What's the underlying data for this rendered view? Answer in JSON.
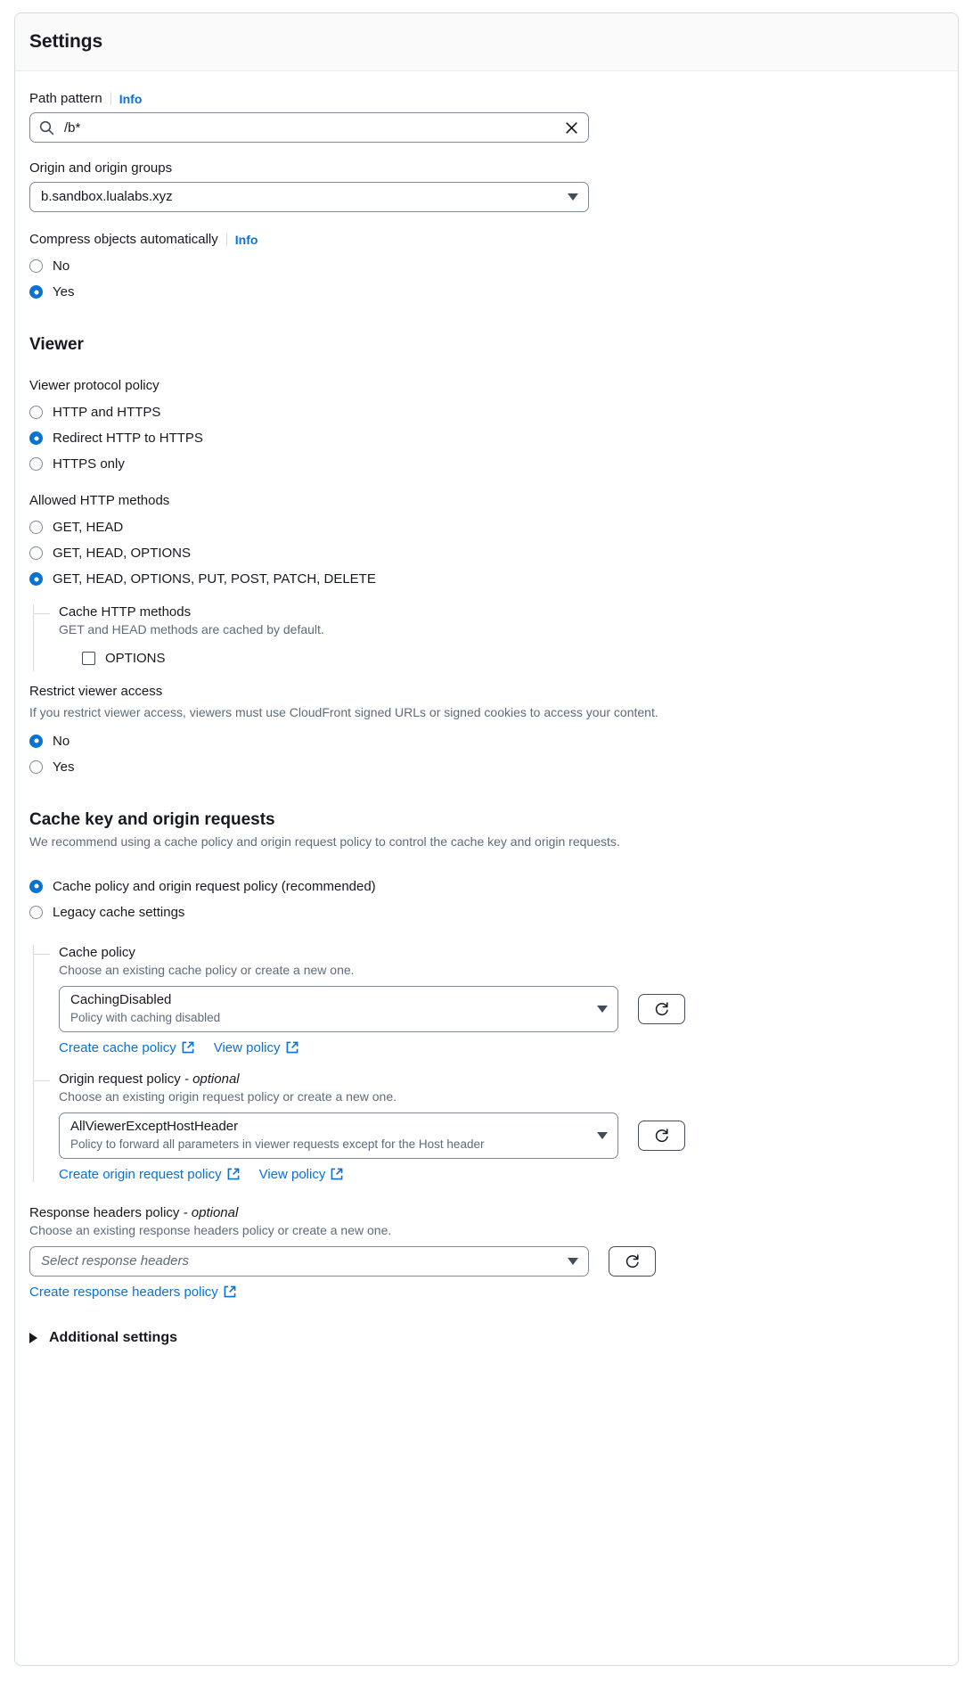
{
  "panel": {
    "title": "Settings"
  },
  "colors": {
    "accent": "#0972d3",
    "link": "#0972d3",
    "border": "#7d8998",
    "muted": "#5f6b7a"
  },
  "path_pattern": {
    "label": "Path pattern",
    "info": "Info",
    "value": "/b*",
    "placeholder": "",
    "search_icon": "search-icon",
    "clear_icon": "close-icon"
  },
  "origin": {
    "label": "Origin and origin groups",
    "value": "b.sandbox.lualabs.xyz"
  },
  "compress": {
    "label": "Compress objects automatically",
    "info": "Info",
    "options": [
      {
        "label": "No",
        "checked": false
      },
      {
        "label": "Yes",
        "checked": true
      }
    ]
  },
  "viewer": {
    "heading": "Viewer",
    "protocol_policy": {
      "label": "Viewer protocol policy",
      "options": [
        {
          "label": "HTTP and HTTPS",
          "checked": false
        },
        {
          "label": "Redirect HTTP to HTTPS",
          "checked": true
        },
        {
          "label": "HTTPS only",
          "checked": false
        }
      ]
    },
    "allowed_methods": {
      "label": "Allowed HTTP methods",
      "options": [
        {
          "label": "GET, HEAD",
          "checked": false
        },
        {
          "label": "GET, HEAD, OPTIONS",
          "checked": false
        },
        {
          "label": "GET, HEAD, OPTIONS, PUT, POST, PATCH, DELETE",
          "checked": true
        }
      ]
    },
    "cache_methods": {
      "label": "Cache HTTP methods",
      "description": "GET and HEAD methods are cached by default.",
      "checkbox_label": "OPTIONS",
      "checked": false
    },
    "restrict": {
      "label": "Restrict viewer access",
      "description": "If you restrict viewer access, viewers must use CloudFront signed URLs or signed cookies to access your content.",
      "options": [
        {
          "label": "No",
          "checked": true
        },
        {
          "label": "Yes",
          "checked": false
        }
      ]
    }
  },
  "cache_key": {
    "heading": "Cache key and origin requests",
    "description": "We recommend using a cache policy and origin request policy to control the cache key and origin requests.",
    "mode_options": [
      {
        "label": "Cache policy and origin request policy (recommended)",
        "checked": true
      },
      {
        "label": "Legacy cache settings",
        "checked": false
      }
    ],
    "cache_policy": {
      "label": "Cache policy",
      "description": "Choose an existing cache policy or create a new one.",
      "value": "CachingDisabled",
      "value_sub": "Policy with caching disabled",
      "refresh_icon": "refresh-icon",
      "links": [
        {
          "label": "Create cache policy",
          "icon": "external-link-icon"
        },
        {
          "label": "View policy",
          "icon": "external-link-icon"
        }
      ]
    },
    "origin_request_policy": {
      "label": "Origin request policy",
      "optional": "- optional",
      "description": "Choose an existing origin request policy or create a new one.",
      "value": "AllViewerExceptHostHeader",
      "value_sub": "Policy to forward all parameters in viewer requests except for the Host header",
      "refresh_icon": "refresh-icon",
      "links": [
        {
          "label": "Create origin request policy",
          "icon": "external-link-icon"
        },
        {
          "label": "View policy",
          "icon": "external-link-icon"
        }
      ]
    }
  },
  "response_headers": {
    "label": "Response headers policy",
    "optional": "- optional",
    "description": "Choose an existing response headers policy or create a new one.",
    "placeholder": "Select response headers",
    "refresh_icon": "refresh-icon",
    "links": [
      {
        "label": "Create response headers policy",
        "icon": "external-link-icon"
      }
    ]
  },
  "additional_settings": {
    "label": "Additional settings",
    "expanded": false
  }
}
